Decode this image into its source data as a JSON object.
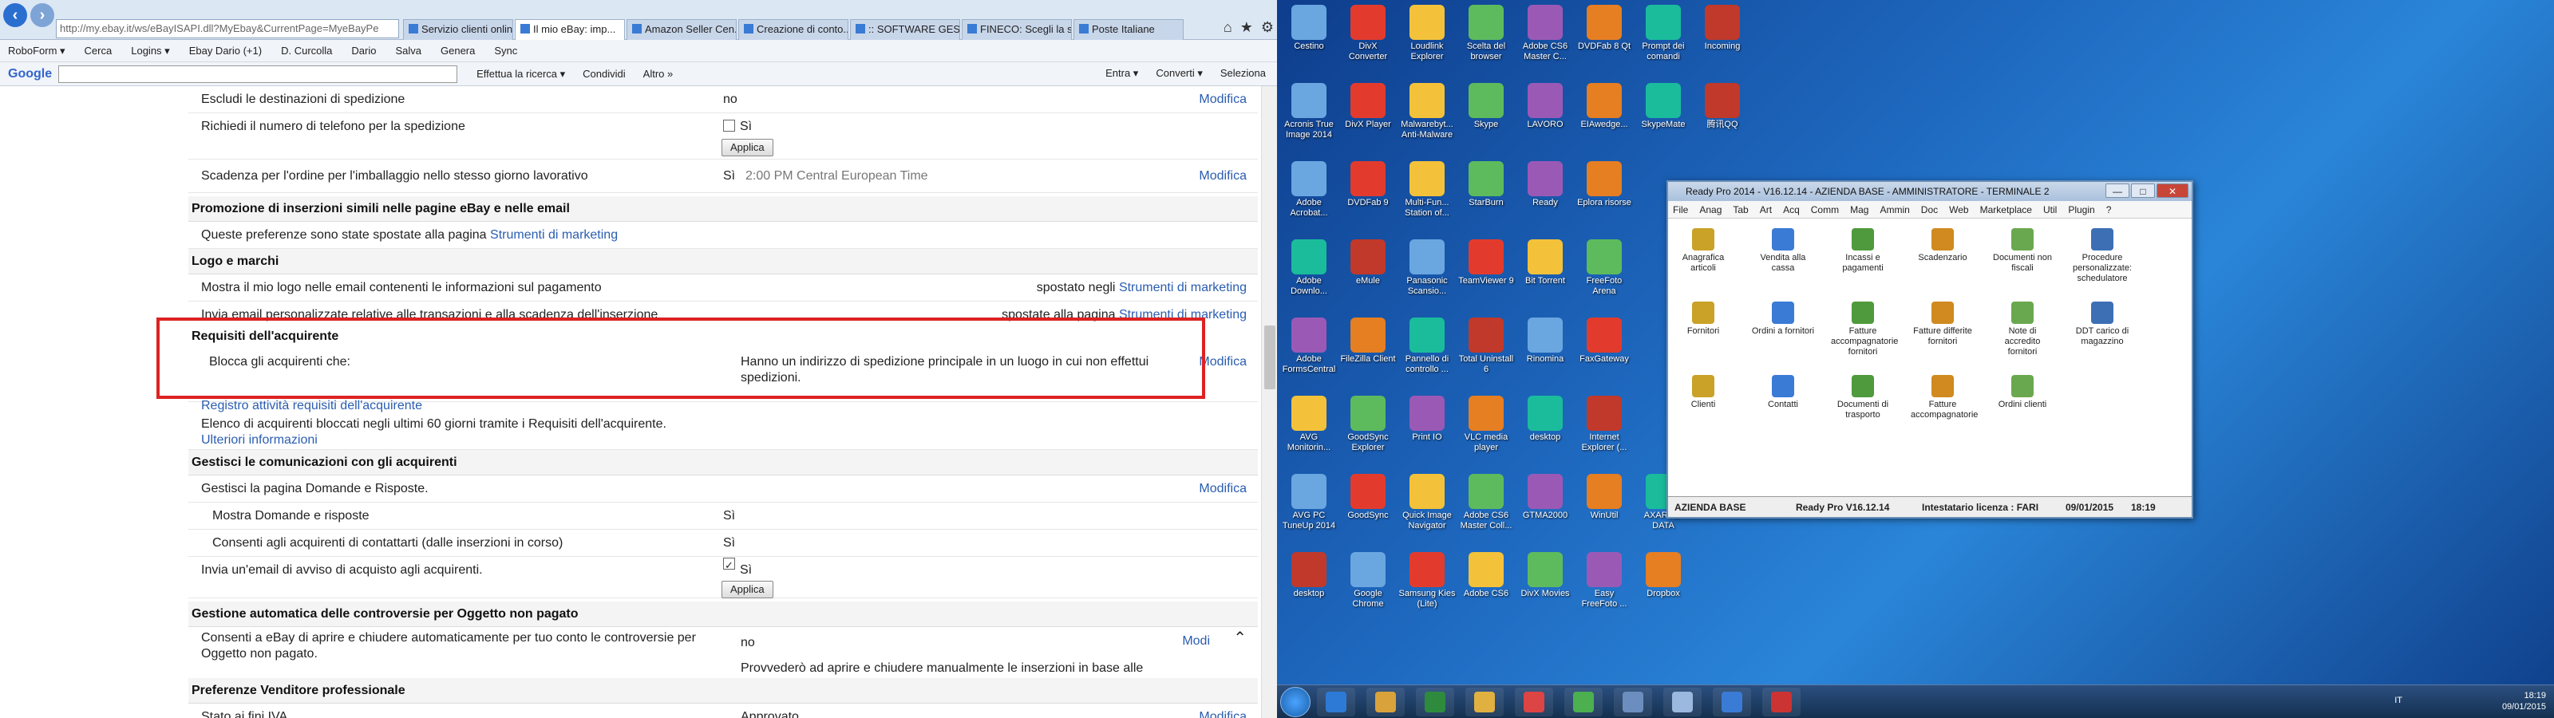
{
  "browser": {
    "url": "http://my.ebay.it/ws/eBayISAPI.dll?MyEbay&CurrentPage=MyeBayPe",
    "tabs": [
      "Servizio clienti online",
      "Il mio eBay: imp...",
      "Amazon Seller Cen...",
      "Creazione di conto...",
      ":: SOFTWARE GESTI...",
      "FINECO: Scegli la s...",
      "Poste Italiane"
    ],
    "toolbar": [
      "RoboForm ▾",
      "Cerca",
      "Logins ▾",
      "Ebay Dario (+1)",
      "D. Curcolla",
      "Dario",
      "Salva",
      "Genera",
      "Sync"
    ],
    "google_label": "Google",
    "google_items": [
      "Effettua la ricerca ▾",
      "Condividi",
      "Altro »"
    ],
    "google_right": [
      "Entra ▾",
      "Converti ▾",
      "Seleziona"
    ]
  },
  "ebay": {
    "r1_label": "Escludi le destinazioni di spedizione",
    "r1_val": "no",
    "r1_act": "Modifica",
    "r2_label": "Richiedi il numero di telefono per la spedizione",
    "r2_val": "Sì",
    "apply": "Applica",
    "r3_label": "Scadenza per l'ordine per l'imballaggio nello stesso giorno lavorativo",
    "r3_val": "Sì",
    "r3_time": "2:00 PM Central European Time",
    "r3_act": "Modifica",
    "s1": "Promozione di inserzioni simili nelle pagine eBay e nelle email",
    "s1_text": "Queste preferenze sono state spostate alla pagina",
    "marketing": "Strumenti di marketing",
    "s2": "Logo e marchi",
    "s2_r1": "Mostra il mio logo nelle email contenenti le informazioni sul pagamento",
    "s2_r1_v": "spostato negli",
    "s2_r2": "Invia email personalizzate relative alle transazioni e alla scadenza dell'inserzione",
    "s2_r2_v": "spostate alla pagina",
    "s3": "Requisiti dell'acquirente",
    "s3_label": "Blocca gli acquirenti che:",
    "s3_val": "Hanno un indirizzo di spedizione principale in un luogo in cui non effettui spedizioni.",
    "s3_act": "Modifica",
    "s3_link": "Registro attività requisiti dell'acquirente",
    "s3_note": "Elenco di acquirenti bloccati negli ultimi 60 giorni tramite i Requisiti dell'acquirente.",
    "s3_more": "Ulteriori informazioni",
    "s4": "Gestisci le comunicazioni con gli acquirenti",
    "s4_r1": "Gestisci la pagina Domande e Risposte.",
    "s4_r1_act": "Modifica",
    "s4_r2": "Mostra Domande e risposte",
    "s4_r2_v": "Sì",
    "s4_r3": "Consenti agli acquirenti di contattarti (dalle inserzioni in corso)",
    "s4_r3_v": "Sì",
    "s4_r4": "Invia un'email di avviso di acquisto agli acquirenti.",
    "s4_r4_v": "Sì",
    "s5": "Gestione automatica delle controversie per Oggetto non pagato",
    "s5_r1": "Consenti a eBay di aprire e chiudere automaticamente per tuo conto le controversie per Oggetto non pagato.",
    "s5_r1_v": "no",
    "s5_act": "Modi",
    "s5_note": "Provvederò ad aprire e chiudere manualmente le inserzioni in base alle esigenze.",
    "s6": "Preferenze Venditore professionale",
    "s6_r1": "Stato ai fini IVA",
    "s6_r1_v": "Approvato",
    "s6_act": "Modifica"
  },
  "desktop": {
    "icons": [
      "Cestino",
      "DivX Converter",
      "Loudlink Explorer",
      "Scelta del browser",
      "Adobe CS6 Master C...",
      "DVDFab 8 Qt",
      "Prompt dei comandi",
      "Incoming",
      "Acronis True Image 2014",
      "DivX Player",
      "Malwarebyt... Anti-Malware",
      "Skype",
      "LAVORO",
      "EIAwedge...",
      "SkypeMate",
      "腾讯QQ",
      "Adobe Acrobat...",
      "DVDFab 9",
      "Multi-Fun... Station of...",
      "StarBurn",
      "Ready",
      "Eplora risorse",
      "Adobe Downlo...",
      "eMule",
      "Panasonic Scansio...",
      "TeamViewer 9",
      "Bit Torrent",
      "FreeFoto Arena",
      "Adobe FormsCentral",
      "FileZilla Client",
      "Pannello di controllo ...",
      "Total Uninstall 6",
      "Rinomina",
      "FaxGateway",
      "AVG Monitorin...",
      "GoodSync Explorer",
      "Print IO",
      "VLC media player",
      "desktop",
      "Internet Explorer (...",
      "AVG PC TuneUp 2014",
      "GoodSync",
      "Quick Image Navigator",
      "Adobe CS6 Master Coll...",
      "GTMA2000",
      "WinUtil",
      "AXARTO-DATA",
      "desktop",
      "Google Chrome",
      "Samsung Kies (Lite)",
      "Adobe CS6",
      "DivX Movies",
      "Easy FreeFoto ...",
      "Dropbox"
    ],
    "readypro": {
      "title": "Ready Pro 2014 - V16.12.14 - AZIENDA BASE - AMMINISTRATORE - TERMINALE 2",
      "menu": [
        "File",
        "Anag",
        "Tab",
        "Art",
        "Acq",
        "Comm",
        "Mag",
        "Ammin",
        "Doc",
        "Web",
        "Marketplace",
        "Util",
        "Plugin",
        "?"
      ],
      "items": [
        "Anagrafica articoli",
        "Vendita alla cassa",
        "Incassi e pagamenti",
        "Scadenzario",
        "Documenti non fiscali",
        "Procedure personalizzate: schedulatore",
        "Fornitori",
        "Ordini a fornitori",
        "Fatture accompagnatorie fornitori",
        "Fatture differite fornitori",
        "Note di accredito fornitori",
        "DDT carico di magazzino",
        "Clienti",
        "Contatti",
        "Documenti di trasporto",
        "Fatture accompagnatorie",
        "Ordini clienti"
      ],
      "status_company": "AZIENDA BASE",
      "status_version": "Ready Pro V16.12.14",
      "status_license": "Intestatario licenza : FARI",
      "status_date": "09/01/2015",
      "status_time": "18:19"
    },
    "tray_lang": "IT",
    "tray_time": "18:19",
    "tray_date": "09/01/2015"
  }
}
